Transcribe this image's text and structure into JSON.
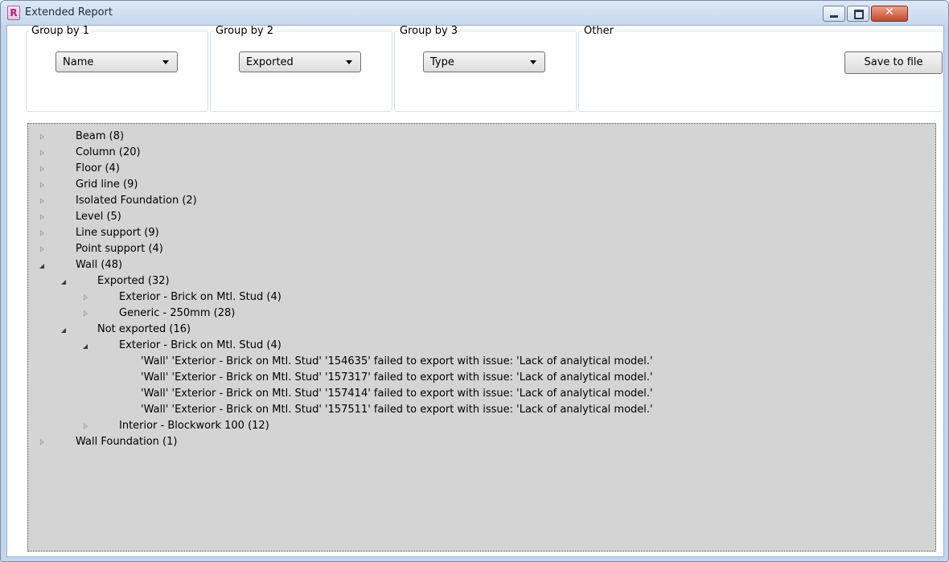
{
  "window": {
    "title": "Extended Report",
    "app_icon_letter": "R",
    "close_glyph": "✕"
  },
  "groups": [
    {
      "legend": "Group by 1",
      "selected": "Name"
    },
    {
      "legend": "Group by 2",
      "selected": "Exported"
    },
    {
      "legend": "Group by 3",
      "selected": "Type"
    }
  ],
  "other": {
    "legend": "Other",
    "save_label": "Save to file"
  },
  "tree": {
    "items": [
      {
        "label": "Beam (8)",
        "level": 0,
        "state": "collapsed"
      },
      {
        "label": "Column (20)",
        "level": 0,
        "state": "collapsed"
      },
      {
        "label": "Floor (4)",
        "level": 0,
        "state": "collapsed"
      },
      {
        "label": "Grid line (9)",
        "level": 0,
        "state": "collapsed"
      },
      {
        "label": "Isolated Foundation (2)",
        "level": 0,
        "state": "collapsed"
      },
      {
        "label": "Level (5)",
        "level": 0,
        "state": "collapsed"
      },
      {
        "label": "Line support (9)",
        "level": 0,
        "state": "collapsed"
      },
      {
        "label": "Point support (4)",
        "level": 0,
        "state": "collapsed"
      },
      {
        "label": "Wall (48)",
        "level": 0,
        "state": "expanded"
      },
      {
        "label": "Exported (32)",
        "level": 1,
        "state": "expanded"
      },
      {
        "label": "Exterior - Brick on Mtl. Stud (4)",
        "level": 2,
        "state": "collapsed"
      },
      {
        "label": "Generic - 250mm (28)",
        "level": 2,
        "state": "collapsed"
      },
      {
        "label": "Not exported (16)",
        "level": 1,
        "state": "expanded"
      },
      {
        "label": "Exterior - Brick on Mtl. Stud (4)",
        "level": 2,
        "state": "expanded"
      },
      {
        "label": "'Wall' 'Exterior - Brick on Mtl. Stud' '154635' failed to export with issue: 'Lack of analytical model.'",
        "level": 3,
        "state": "leaf"
      },
      {
        "label": "'Wall' 'Exterior - Brick on Mtl. Stud' '157317' failed to export with issue: 'Lack of analytical model.'",
        "level": 3,
        "state": "leaf"
      },
      {
        "label": "'Wall' 'Exterior - Brick on Mtl. Stud' '157414' failed to export with issue: 'Lack of analytical model.'",
        "level": 3,
        "state": "leaf"
      },
      {
        "label": "'Wall' 'Exterior - Brick on Mtl. Stud' '157511' failed to export with issue: 'Lack of analytical model.'",
        "level": 3,
        "state": "leaf"
      },
      {
        "label": "Interior - Blockwork 100 (12)",
        "level": 2,
        "state": "collapsed"
      },
      {
        "label": "Wall Foundation (1)",
        "level": 0,
        "state": "collapsed"
      }
    ]
  }
}
